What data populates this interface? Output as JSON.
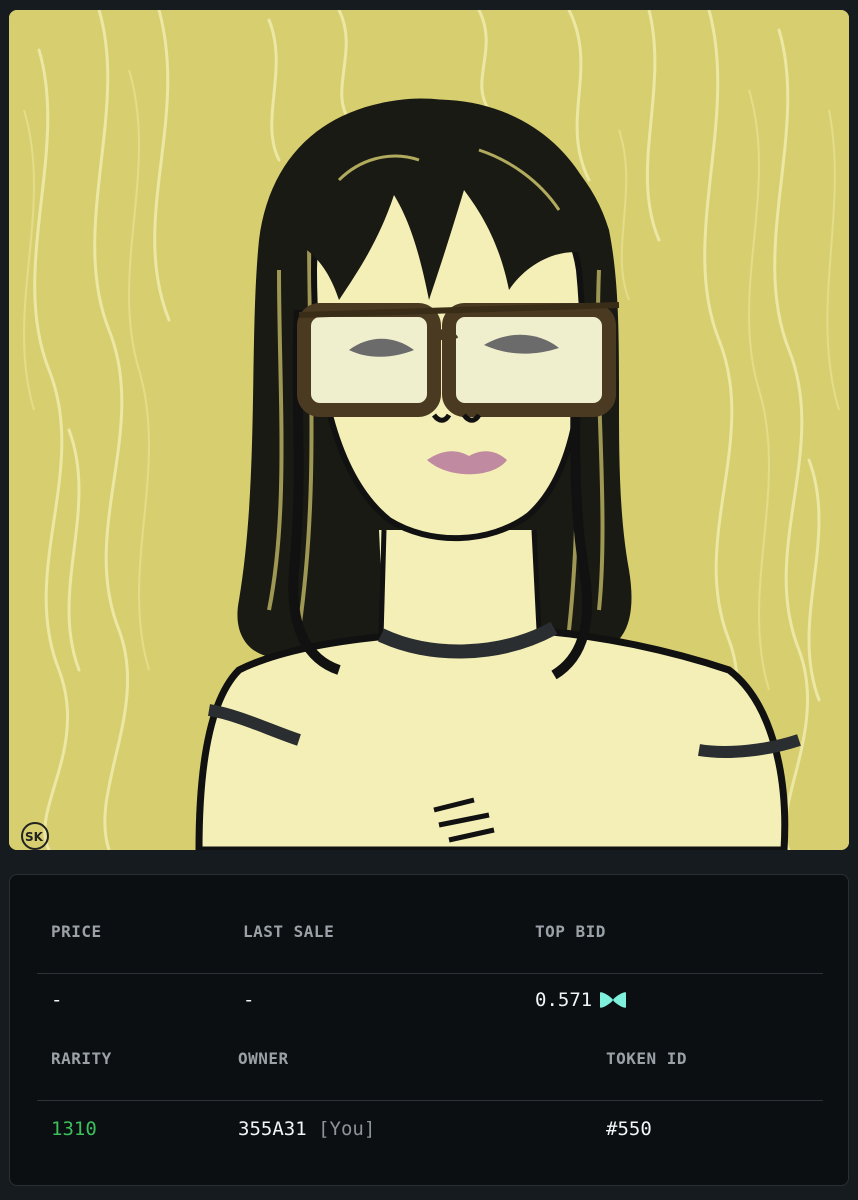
{
  "artwork": {
    "signature": "SK",
    "colors": {
      "background": "#d7cf6f",
      "skin": "#f3efb6",
      "outline": "#111111",
      "lips": "#c08aa0"
    }
  },
  "stats": {
    "price": {
      "label": "PRICE",
      "value": "-"
    },
    "last_sale": {
      "label": "LAST SALE",
      "value": "-"
    },
    "top_bid": {
      "label": "TOP BID",
      "value": "0.571",
      "currency_icon": "bowtie-currency-icon",
      "icon_color": "#7ff0dc"
    },
    "rarity": {
      "label": "RARITY",
      "value": "1310",
      "color": "#3bbf5c"
    },
    "owner": {
      "label": "OWNER",
      "value": "355A31",
      "you_tag": "[You]"
    },
    "token_id": {
      "label": "TOKEN ID",
      "value": "#550"
    }
  }
}
